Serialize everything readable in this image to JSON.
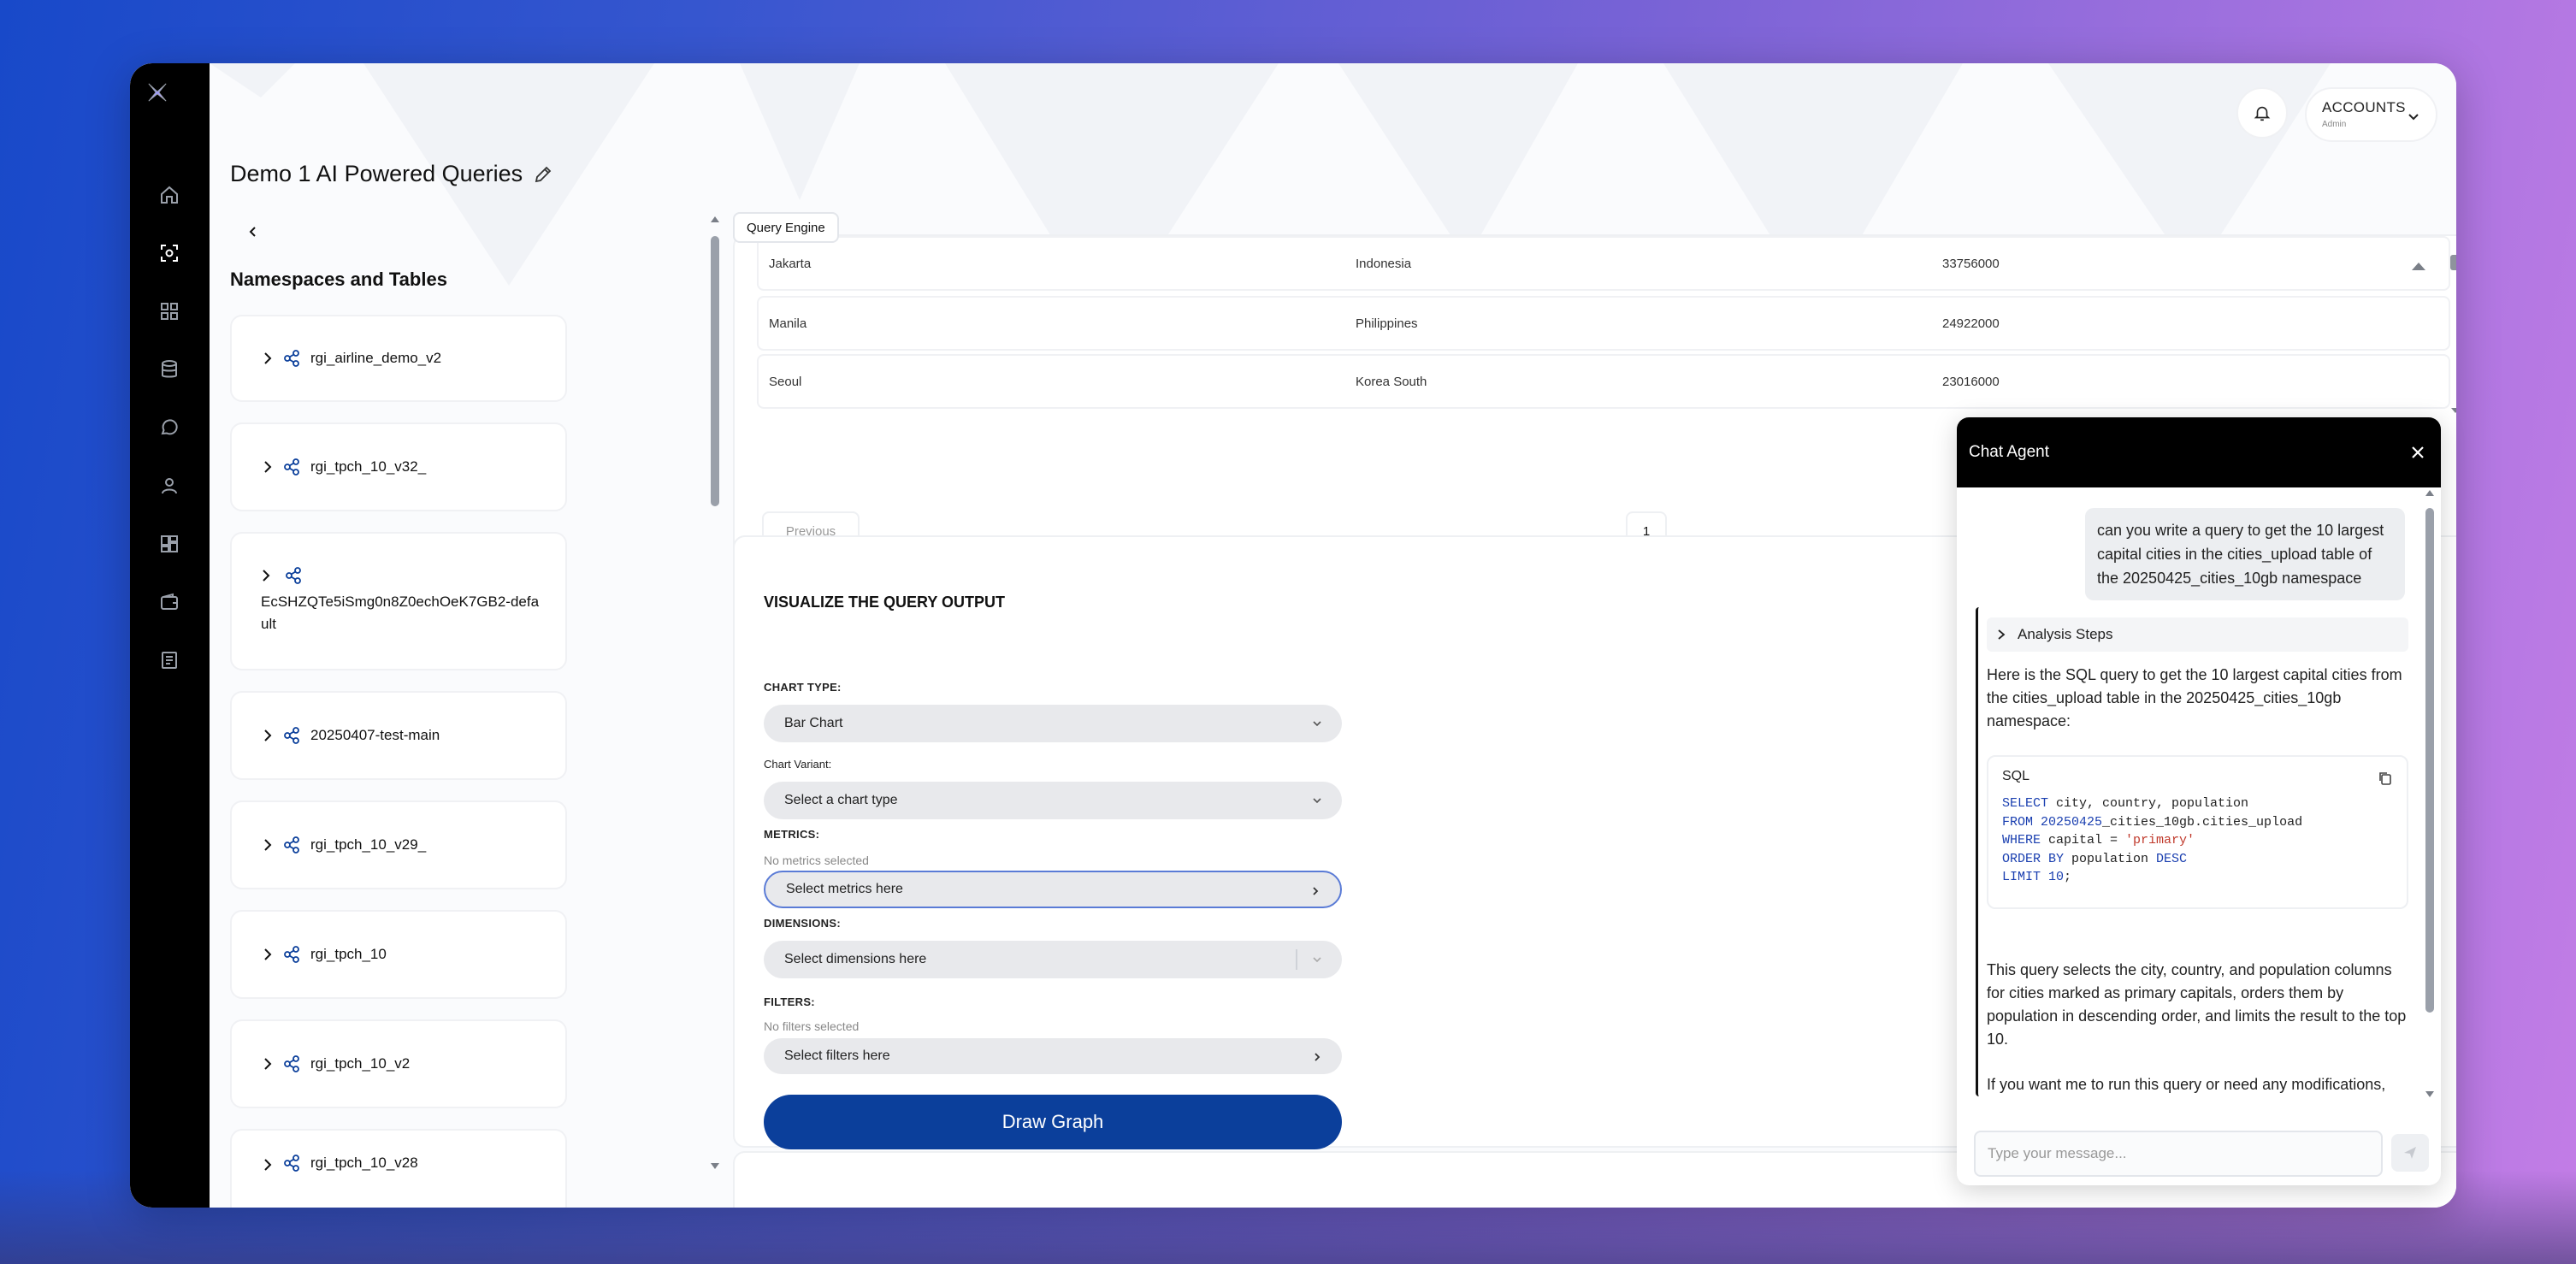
{
  "app": {
    "notifications_icon": "bell-icon",
    "logo_icon": "x-logo-icon"
  },
  "account": {
    "label": "ACCOUNTS",
    "role": "Admin"
  },
  "rail": [
    "home-icon",
    "query-scan-icon",
    "dashboard-icon",
    "database-icon",
    "chat-icon",
    "user-icon",
    "widgets-icon",
    "wallet-icon",
    "report-icon"
  ],
  "page": {
    "title": "Demo 1 AI Powered Queries"
  },
  "namespaces": {
    "heading": "Namespaces and Tables",
    "items": [
      {
        "name": "rgi_airline_demo_v2"
      },
      {
        "name": "rgi_tpch_10_v32_"
      },
      {
        "name": "EcSHZQTe5iSmg0n8Z0echOeK7GB2-default"
      },
      {
        "name": "20250407-test-main"
      },
      {
        "name": "rgi_tpch_10_v29_"
      },
      {
        "name": "rgi_tpch_10"
      },
      {
        "name": "rgi_tpch_10_v2"
      },
      {
        "name": "rgi_tpch_10_v28"
      }
    ]
  },
  "query_engine": {
    "tab_label": "Query Engine",
    "rows": [
      {
        "city": "Jakarta",
        "country": "Indonesia",
        "population": "33756000"
      },
      {
        "city": "Manila",
        "country": "Philippines",
        "population": "24922000"
      },
      {
        "city": "Seoul",
        "country": "Korea South",
        "population": "23016000"
      }
    ],
    "previous_label": "Previous",
    "page_number": "1"
  },
  "visualize": {
    "heading": "VISUALIZE THE QUERY OUTPUT",
    "chart_type_label": "CHART TYPE:",
    "chart_type_value": "Bar Chart",
    "chart_variant_label": "Chart Variant:",
    "chart_variant_placeholder": "Select a chart type",
    "metrics_label": "METRICS:",
    "metrics_status": "No metrics selected",
    "metrics_placeholder": "Select metrics here",
    "dimensions_label": "DIMENSIONS:",
    "dimensions_placeholder": "Select dimensions here",
    "filters_label": "FILTERS:",
    "filters_status": "No filters selected",
    "filters_placeholder": "Select filters here",
    "draw_button": "Draw Graph"
  },
  "chat": {
    "title": "Chat Agent",
    "user_message": "can you write a query to get the 10 largest capital cities in the cities_upload table of the 20250425_cities_10gb namespace",
    "analysis_label": "Analysis Steps",
    "intro": "Here is the SQL query to get the 10 largest capital cities from the cities_upload table in the 20250425_cities_10gb namespace:",
    "sql_label": "SQL",
    "sql": {
      "l1_kw": "SELECT",
      "l1_rest": " city, country, population",
      "l2_kw": "FROM",
      "l2_num": " 20250425",
      "l2_rest": "_cities_10gb.cities_upload",
      "l3_kw": "WHERE",
      "l3_rest": " capital = ",
      "l3_str": "'primary'",
      "l4_kw": "ORDER BY",
      "l4_mid": " population ",
      "l4_kw2": "DESC",
      "l5_kw": "LIMIT",
      "l5_num": " 10",
      "l5_rest": ";"
    },
    "explanation": "This query selects the city, country, and population columns for cities marked as primary capitals, orders them by population in descending order, and limits the result to the top 10.",
    "followup": "If you want me to run this query or need any modifications,",
    "input_placeholder": "Type your message..."
  }
}
